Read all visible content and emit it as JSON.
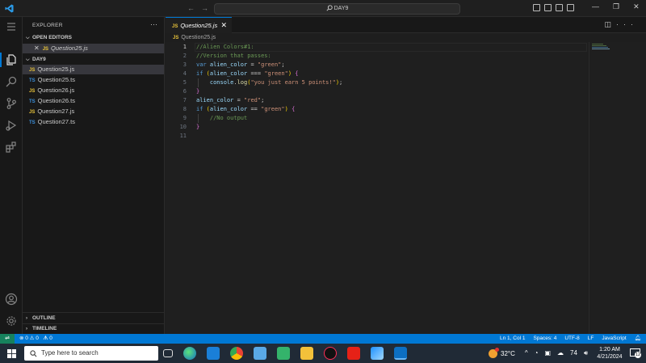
{
  "titlebar": {
    "search_text": "DAY9",
    "back_arrow": "←",
    "forward_arrow": "→",
    "minimize": "—",
    "restore": "❐",
    "close": "✕"
  },
  "sidebar": {
    "title": "EXPLORER",
    "more": "···",
    "open_editors_label": "OPEN EDITORS",
    "open_editor_file": "Question25.js",
    "folder_label": "DAY9",
    "files": [
      {
        "name": "Question25.js",
        "type": "JS"
      },
      {
        "name": "Question25.ts",
        "type": "TS"
      },
      {
        "name": "Question26.js",
        "type": "JS"
      },
      {
        "name": "Question26.ts",
        "type": "TS"
      },
      {
        "name": "Question27.js",
        "type": "JS"
      },
      {
        "name": "Question27.ts",
        "type": "TS"
      }
    ],
    "outline_label": "OUTLINE",
    "timeline_label": "TIMELINE"
  },
  "editor": {
    "tab_label": "Question25.js",
    "tab_badge": "JS",
    "breadcrumb": "Question25.js",
    "line_numbers": [
      "1",
      "2",
      "3",
      "4",
      "5",
      "6",
      "7",
      "8",
      "9",
      "10",
      "11"
    ]
  },
  "statusbar": {
    "remote": "⇌",
    "errors": "⊗ 0 ⚠ 0",
    "ports": "ᗑ 0",
    "position": "Ln 1, Col 1",
    "spaces": "Spaces: 4",
    "encoding": "UTF-8",
    "eol": "LF",
    "language": "JavaScript"
  },
  "taskbar": {
    "search_placeholder": "Type here to search",
    "temperature": "32°C",
    "battery": "74",
    "time": "1:20 AM",
    "date": "4/21/2024",
    "notifications": "12"
  },
  "colors": {
    "accent": "#0078d4",
    "statusbar": "#0078d4",
    "remote": "#16825d",
    "js_badge": "#e8c33a",
    "ts_badge": "#3b8fd9"
  }
}
